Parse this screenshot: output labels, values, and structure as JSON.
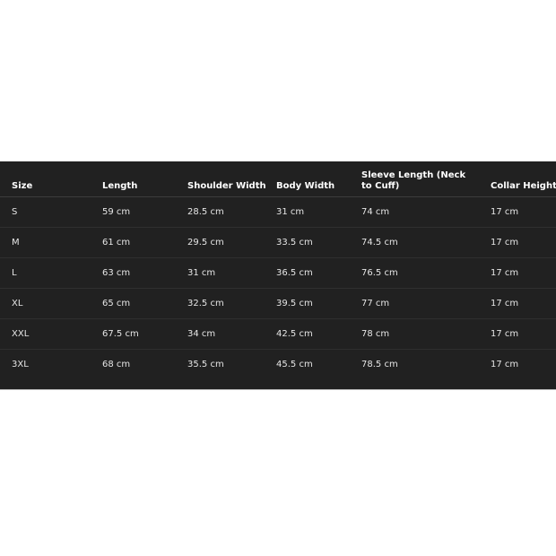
{
  "table": {
    "headers": [
      "Size",
      "Length",
      "Shoulder Width",
      "Body Width",
      "Sleeve Length (Neck to Cuff)",
      "Collar Height"
    ],
    "rows": [
      [
        "S",
        "59 cm",
        "28.5 cm",
        "31 cm",
        "74 cm",
        "17 cm"
      ],
      [
        "M",
        "61 cm",
        "29.5 cm",
        "33.5 cm",
        "74.5 cm",
        "17 cm"
      ],
      [
        "L",
        "63 cm",
        "31 cm",
        "36.5 cm",
        "76.5 cm",
        "17 cm"
      ],
      [
        "XL",
        "65 cm",
        "32.5 cm",
        "39.5 cm",
        "77 cm",
        "17 cm"
      ],
      [
        "XXL",
        "67.5 cm",
        "34 cm",
        "42.5 cm",
        "78 cm",
        "17 cm"
      ],
      [
        "3XL",
        "68 cm",
        "35.5 cm",
        "45.5 cm",
        "78.5 cm",
        "17 cm"
      ]
    ]
  },
  "colors": {
    "panel_background": "#212121",
    "text": "#ececec",
    "page_background": "#ffffff"
  }
}
